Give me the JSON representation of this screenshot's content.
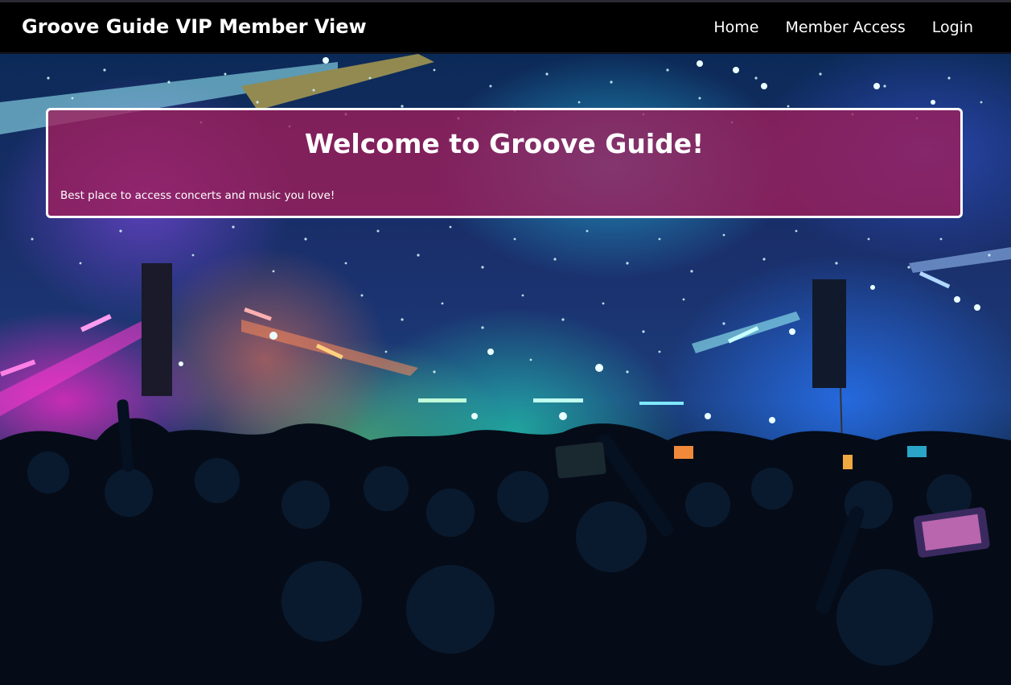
{
  "navbar": {
    "brand": "Groove Guide VIP Member View",
    "links": [
      "Home",
      "Member Access",
      "Login"
    ]
  },
  "hero": {
    "image": "concert-crowd-background"
  },
  "welcome": {
    "title": "Welcome to Groove Guide!",
    "subtitle": "Best place to access concerts and music you love!"
  },
  "colors": {
    "navbar_bg": "#000000",
    "welcome_panel_bg": "#a01e5a",
    "welcome_border": "#ffffff",
    "text": "#ffffff"
  }
}
